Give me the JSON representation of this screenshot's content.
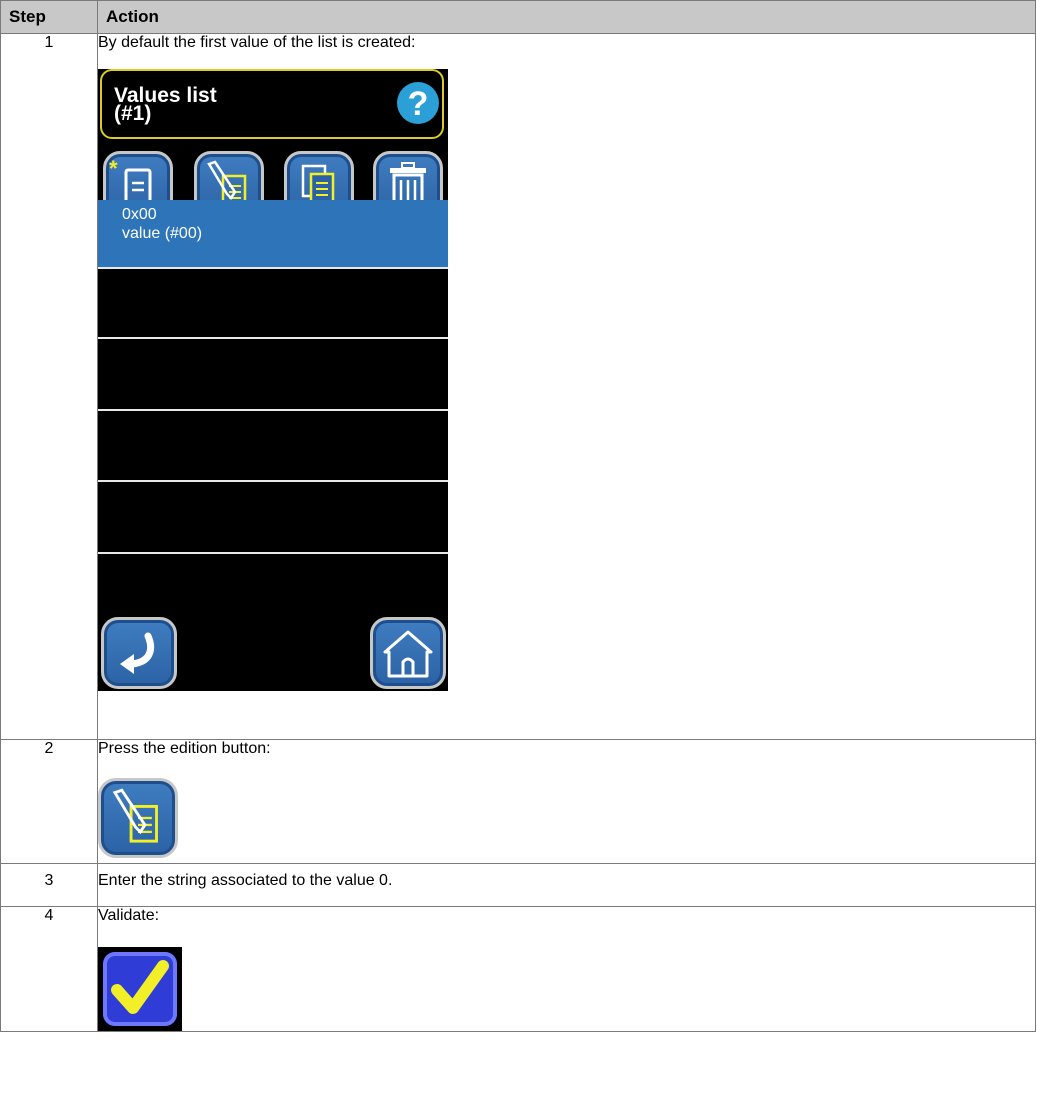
{
  "table": {
    "header_step": "Step",
    "header_action": "Action"
  },
  "rows": [
    {
      "step": "1",
      "text": "By default the first value of the list is created:"
    },
    {
      "step": "2",
      "text": "Press the edition button:"
    },
    {
      "step": "3",
      "text": "Enter the string associated to the value 0."
    },
    {
      "step": "4",
      "text": "Validate:"
    }
  ],
  "screen": {
    "title_line1": "Values list",
    "title_line2": "(#1)",
    "help_symbol": "?",
    "selected_item": {
      "line1": "0x00",
      "line2": "value (#00)"
    },
    "colors": {
      "background": "#000000",
      "header_border": "#d9cc27",
      "selected_item": "#2e74b8",
      "button_blue": "#2b62a5",
      "icon_yellow": "#f2ee27",
      "help": "#2aa0d6"
    },
    "toolbar_icons": [
      "new-value-icon",
      "edit-value-icon",
      "copy-value-icon",
      "delete-value-icon"
    ],
    "bottom_icons": [
      "back-icon",
      "home-icon"
    ]
  },
  "validate_color": "#2f3dd6"
}
